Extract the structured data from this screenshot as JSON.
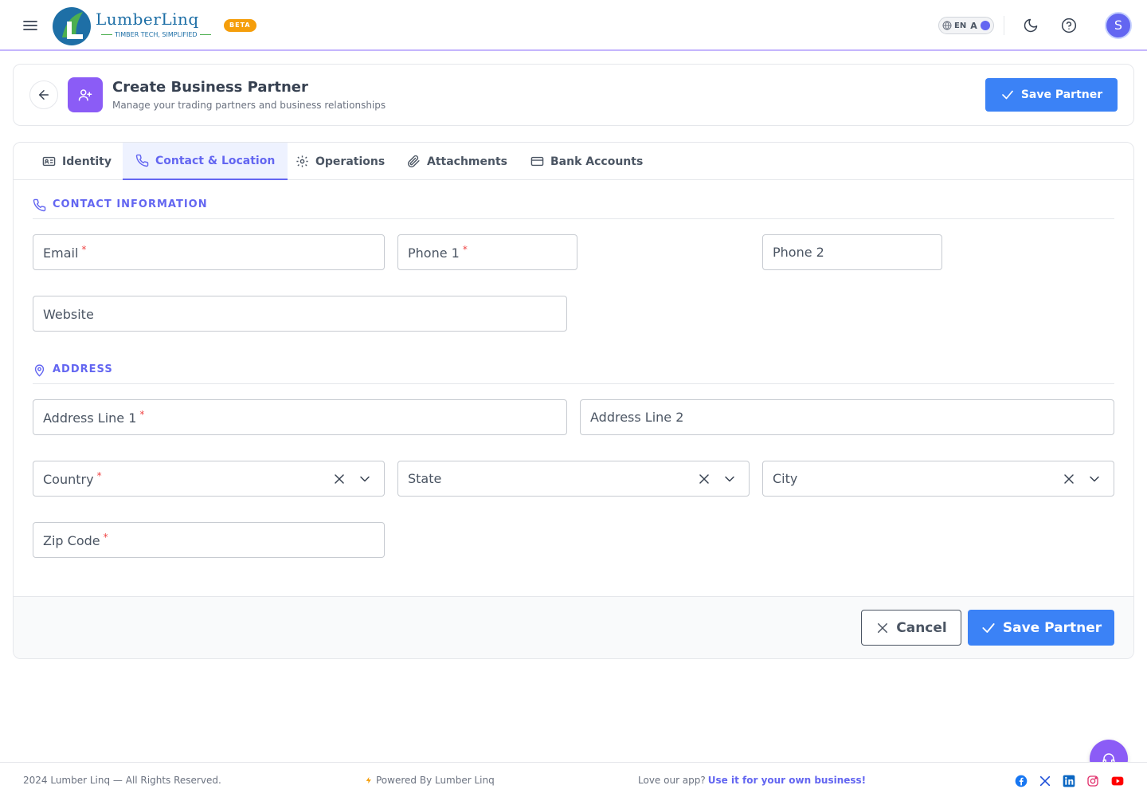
{
  "brand": {
    "name": "LumberLinq",
    "tagline": "TIMBER TECH, SIMPLIFIED",
    "badge": "BETA",
    "colors": {
      "primary": "#3b82f6",
      "accent": "#6366f1",
      "purple": "#8b5cf6",
      "required": "#ef4444",
      "badge": "#f59e0b"
    }
  },
  "topbar": {
    "language_code": "EN",
    "language_alt": "A",
    "avatar_initial": "S",
    "icons": [
      "menu-icon",
      "globe-icon",
      "moon-icon",
      "help-icon"
    ]
  },
  "header": {
    "title": "Create Business Partner",
    "subtitle": "Manage your trading partners and business relationships",
    "save_label": "Save Partner"
  },
  "tabs": [
    {
      "label": "Identity",
      "icon": "id-card-icon",
      "active": false
    },
    {
      "label": "Contact & Location",
      "icon": "phone-icon",
      "active": true
    },
    {
      "label": "Operations",
      "icon": "gear-icon",
      "active": false
    },
    {
      "label": "Attachments",
      "icon": "paperclip-icon",
      "active": false
    },
    {
      "label": "Bank Accounts",
      "icon": "credit-card-icon",
      "active": false
    }
  ],
  "contact": {
    "section_title": "CONTACT INFORMATION",
    "email": {
      "label": "Email",
      "required": true,
      "value": ""
    },
    "phone1": {
      "label": "Phone 1",
      "required": true,
      "value": ""
    },
    "phone2": {
      "label": "Phone 2",
      "required": false,
      "value": ""
    },
    "website": {
      "label": "Website",
      "required": false,
      "value": ""
    }
  },
  "address": {
    "section_title": "ADDRESS",
    "line1": {
      "label": "Address Line 1",
      "required": true,
      "value": ""
    },
    "line2": {
      "label": "Address Line 2",
      "required": false,
      "value": ""
    },
    "country": {
      "label": "Country",
      "required": true,
      "value": ""
    },
    "state": {
      "label": "State",
      "required": false,
      "value": ""
    },
    "city": {
      "label": "City",
      "required": false,
      "value": ""
    },
    "zip": {
      "label": "Zip Code",
      "required": true,
      "value": ""
    }
  },
  "required_mark": "*",
  "actions": {
    "cancel_label": "Cancel",
    "save_label": "Save Partner"
  },
  "footer": {
    "copyright": "2024 Lumber Linq — All Rights Reserved.",
    "powered_by": "Powered By Lumber Linq",
    "promo_text": "Love our app?",
    "promo_link": "Use it for your own business!",
    "social": [
      "facebook-icon",
      "x-icon",
      "linkedin-icon",
      "instagram-icon",
      "youtube-icon"
    ]
  }
}
